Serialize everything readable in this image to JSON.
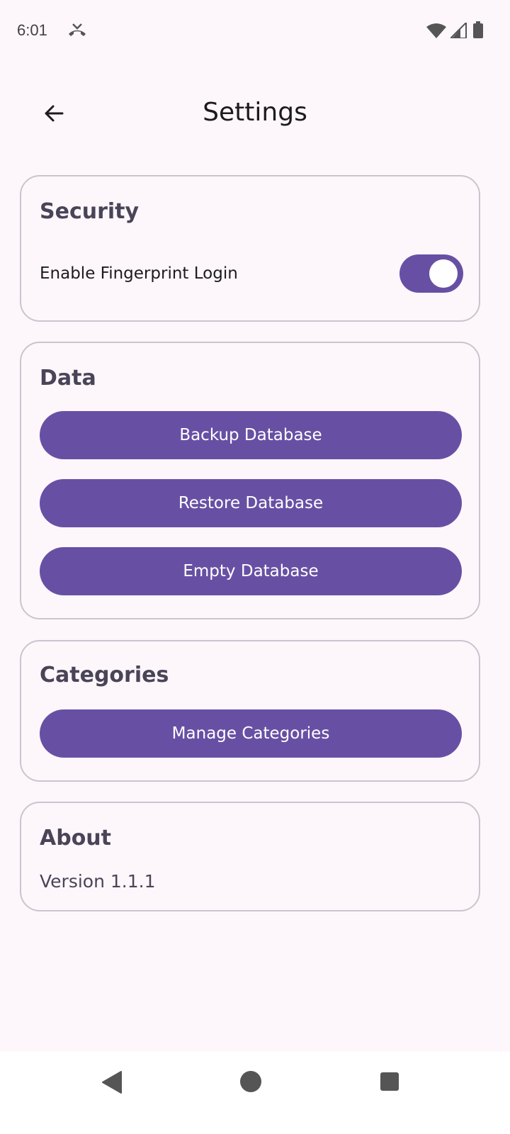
{
  "status_bar": {
    "time": "6:01",
    "icons": [
      "missed-call-icon",
      "wifi-icon",
      "signal-icon",
      "battery-icon"
    ]
  },
  "app_bar": {
    "title": "Settings",
    "back_icon": "arrow-back-icon"
  },
  "security": {
    "title": "Security",
    "fingerprint_label": "Enable Fingerprint Login",
    "fingerprint_enabled": true
  },
  "data_section": {
    "title": "Data",
    "buttons": [
      "Backup Database",
      "Restore Database",
      "Empty Database"
    ]
  },
  "categories": {
    "title": "Categories",
    "manage_button": "Manage Categories"
  },
  "about": {
    "title": "About",
    "version": "Version 1.1.1"
  },
  "nav_bar": {
    "icons": [
      "nav-back-icon",
      "nav-home-icon",
      "nav-recents-icon"
    ]
  },
  "colors": {
    "background": "#fdf7fc",
    "primary": "#6750a4",
    "card_border": "#cbc4cf",
    "section_title": "#4a4458"
  }
}
